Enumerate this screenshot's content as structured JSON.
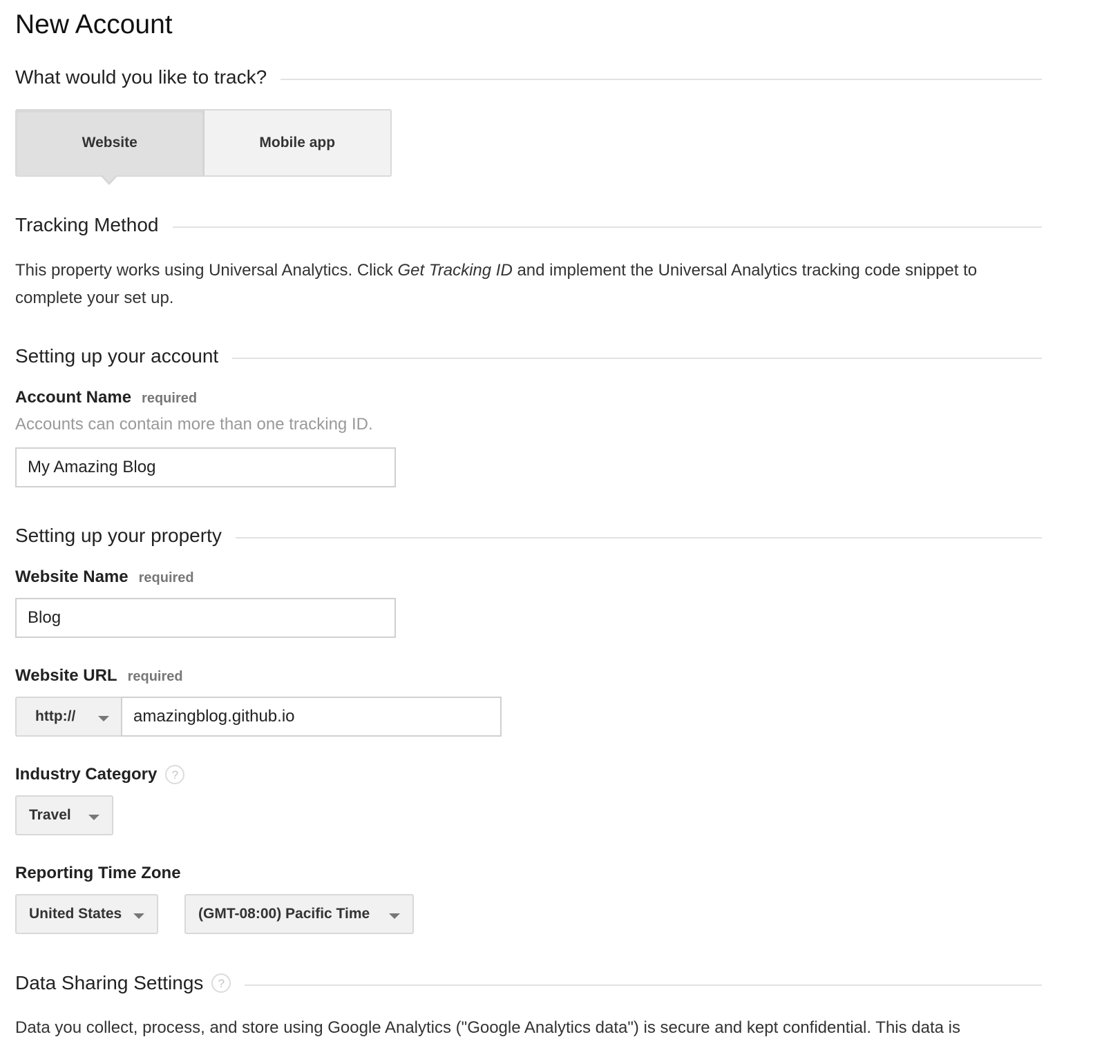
{
  "page": {
    "title": "New Account"
  },
  "track_section": {
    "title": "What would you like to track?",
    "options": [
      {
        "label": "Website",
        "selected": true
      },
      {
        "label": "Mobile app",
        "selected": false
      }
    ]
  },
  "tracking_method": {
    "title": "Tracking Method",
    "text_before": "This property works using Universal Analytics. Click ",
    "text_emphasis": "Get Tracking ID",
    "text_after": " and implement the Universal Analytics tracking code snippet to complete your set up."
  },
  "account_section": {
    "title": "Setting up your account",
    "account_name": {
      "label": "Account Name",
      "required_label": "required",
      "hint": "Accounts can contain more than one tracking ID.",
      "value": "My Amazing Blog"
    }
  },
  "property_section": {
    "title": "Setting up your property",
    "website_name": {
      "label": "Website Name",
      "required_label": "required",
      "value": "Blog"
    },
    "website_url": {
      "label": "Website URL",
      "required_label": "required",
      "protocol": "http://",
      "value": "amazingblog.github.io"
    },
    "industry_category": {
      "label": "Industry Category",
      "help_icon": "help-icon",
      "help_glyph": "?",
      "value": "Travel"
    },
    "reporting_time_zone": {
      "label": "Reporting Time Zone",
      "country": "United States",
      "time_zone": "(GMT-08:00) Pacific Time"
    }
  },
  "data_sharing": {
    "title": "Data Sharing Settings",
    "help_glyph": "?",
    "text": "Data you collect, process, and store using Google Analytics (\"Google Analytics data\") is secure and kept confidential. This data is"
  },
  "colors": {
    "selected_segment": "#e0e0e0",
    "unselected_segment": "#f2f2f2",
    "divider": "#e2e2e2",
    "required_text": "#777777",
    "hint_text": "#999999"
  }
}
